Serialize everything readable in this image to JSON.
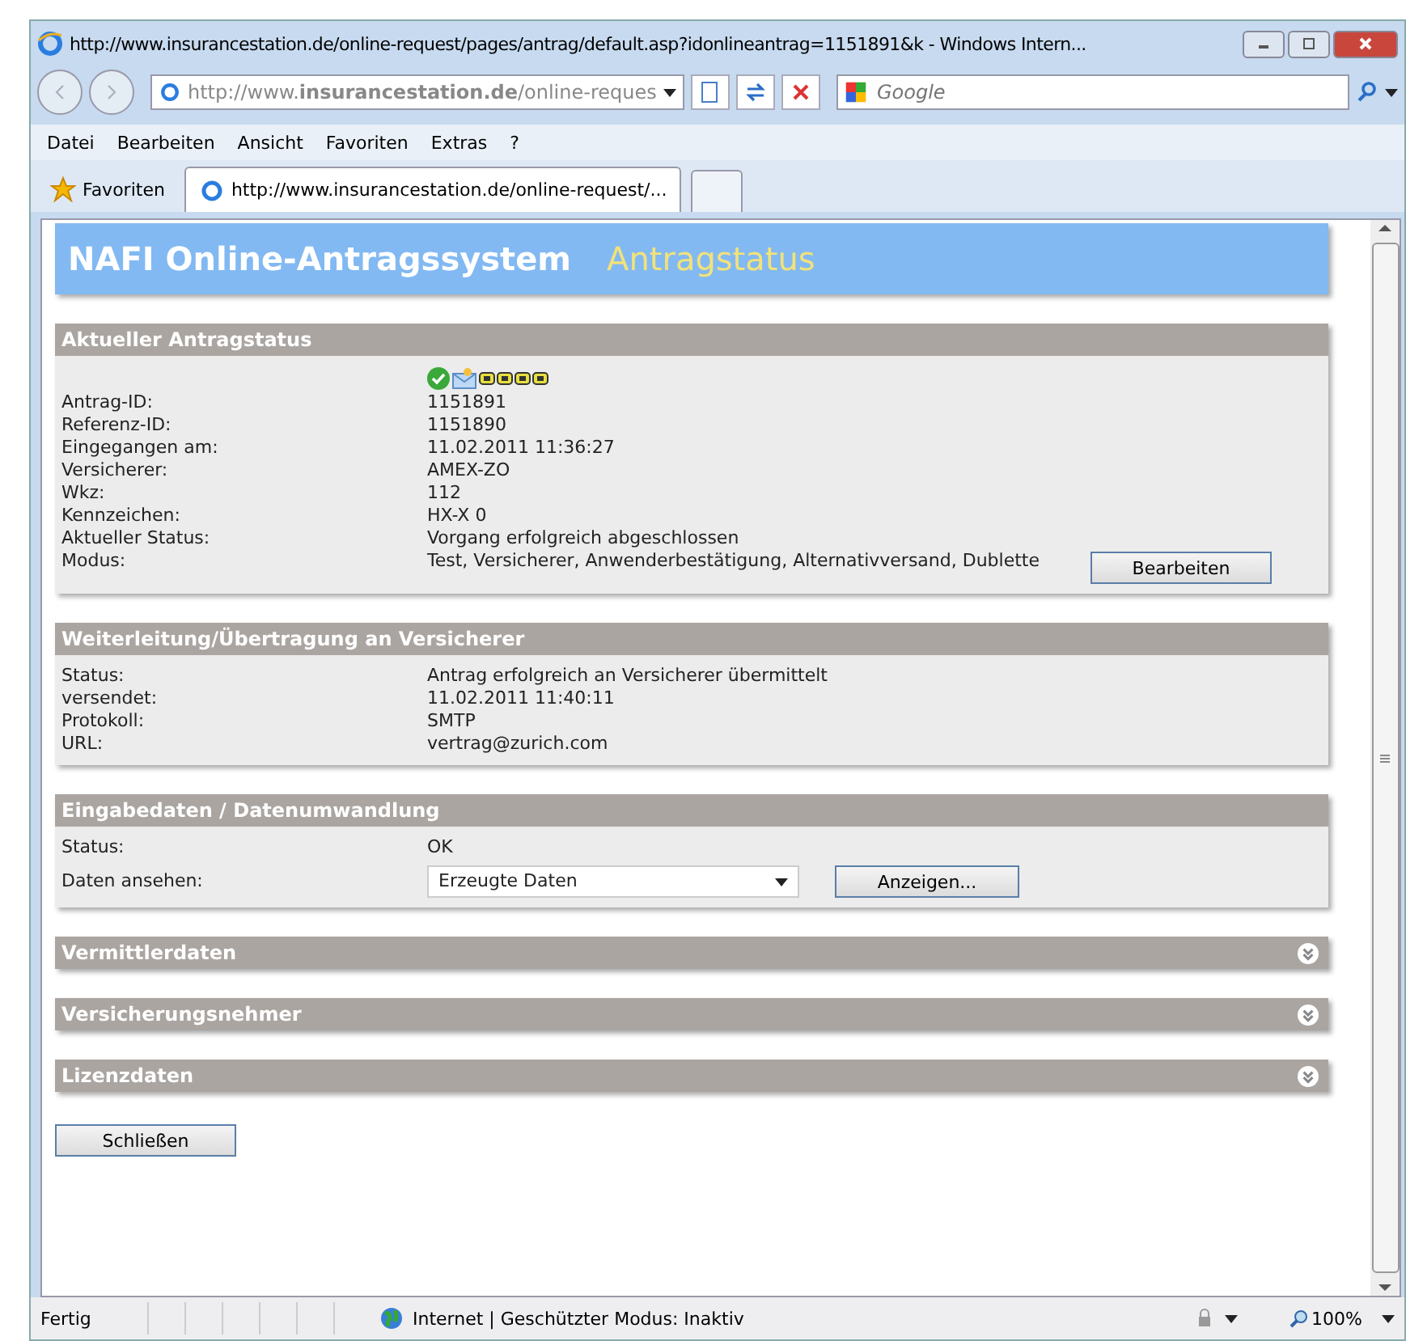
{
  "window": {
    "title": "http://www.insurancestation.de/online-request/pages/antrag/default.asp?idonlineantrag=1151891&k - Windows Intern..."
  },
  "address_bar": {
    "value": "http://www.**insurancestation.de**/online-reques"
  },
  "search": {
    "placeholder": "Google"
  },
  "menu": [
    "Datei",
    "Bearbeiten",
    "Ansicht",
    "Favoriten",
    "Extras",
    "?"
  ],
  "favorites": {
    "label": "Favoriten"
  },
  "tabs": [
    {
      "label": "http://www.insurancestation.de/online-request/...",
      "selected": true
    }
  ],
  "page": {
    "title": "NAFI Online-Antragssystem",
    "subtitle": "Antragstatus"
  },
  "sections": [
    {
      "title": "Aktueller Antragstatus",
      "expanded": true,
      "kind": "status",
      "rows": [
        {
          "label": "Antrag-ID:",
          "value": "1151891"
        },
        {
          "label": "Referenz-ID:",
          "value": "1151890"
        },
        {
          "label": "Eingegangen am:",
          "value": "11.02.2011 11:36:27"
        },
        {
          "label": "Versicherer:",
          "value": "AMEX-ZO"
        },
        {
          "label": "Wkz:",
          "value": "112"
        },
        {
          "label": "Kennzeichen:",
          "value": "HX-X 0"
        },
        {
          "label": "Aktueller Status:",
          "value": "Vorgang erfolgreich abgeschlossen"
        },
        {
          "label": "Modus:",
          "value": "Test, Versicherer, Anwenderbestätigung, Alternativversand, Dublette"
        }
      ],
      "button": "Bearbeiten"
    },
    {
      "title": "Weiterleitung/Übertragung an Versicherer",
      "expanded": true,
      "kind": "rows",
      "rows": [
        {
          "label": "Status:",
          "value": "Antrag erfolgreich an Versicherer übermittelt"
        },
        {
          "label": "versendet:",
          "value": "11.02.2011 11:40:11"
        },
        {
          "label": "Protokoll:",
          "value": "SMTP"
        },
        {
          "label": "URL:",
          "value": "vertrag@zurich.com"
        }
      ]
    },
    {
      "title": "Eingabedaten / Datenumwandlung",
      "expanded": true,
      "kind": "data",
      "rows": [
        {
          "label": "Status:",
          "value": "OK"
        }
      ],
      "select_label": "Daten ansehen:",
      "select_value": "Erzeugte Daten",
      "button": "Anzeigen..."
    },
    {
      "title": "Vermittlerdaten",
      "expanded": false
    },
    {
      "title": "Versicherungsnehmer",
      "expanded": false
    },
    {
      "title": "Lizenzdaten",
      "expanded": false
    }
  ],
  "close_button": "Schließen",
  "status_bar": {
    "text": "Fertig",
    "zone": "Internet | Geschützter Modus: Inaktiv",
    "zoom": "100%"
  }
}
